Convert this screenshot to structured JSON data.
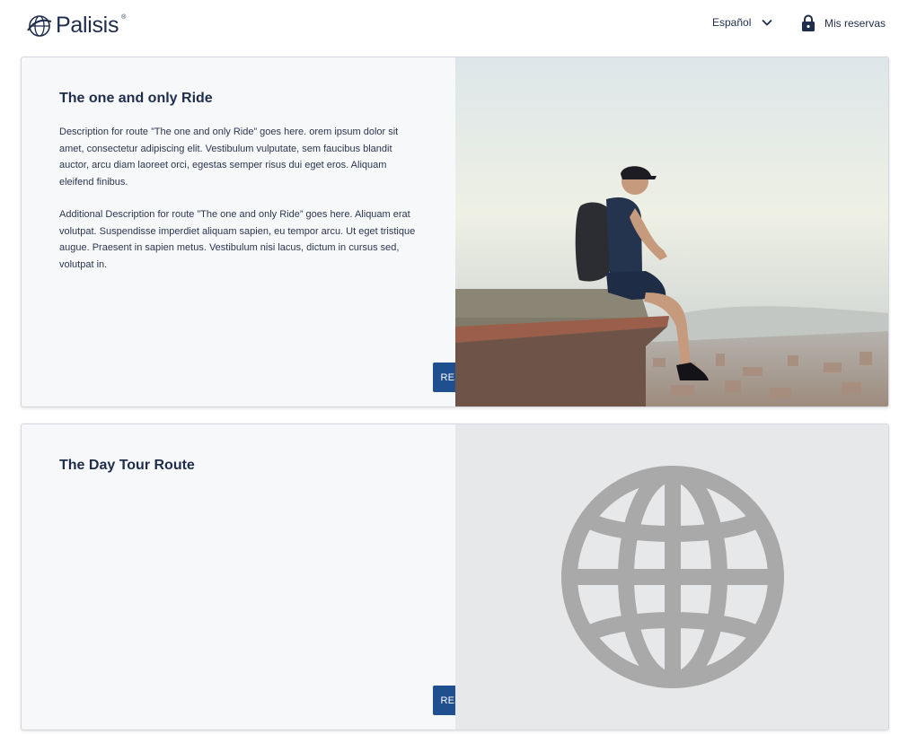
{
  "header": {
    "logo_text": "Palisis",
    "logo_mark": "®",
    "language_label": "Español",
    "my_bookings_label": "Mis reservas"
  },
  "routes": [
    {
      "title": "The one and only Ride",
      "description": "Description for route ”The one and only Ride” goes here. orem ipsum dolor sit amet, consectetur adipiscing elit. Vestibulum vulputate, sem faucibus blandit auctor, arcu diam laoreet orci, egestas semper risus dui eget eros. Aliquam eleifend finibus.",
      "additional_description": "Additional Description for route ”The one and only Ride” goes here. Aliquam erat volutpat. Suspendisse imperdiet aliquam sapien, eu tempor arcu. Ut eget tristique augue. Praesent in sapien metus. Vestibulum nisi lacus, dictum in cursus sed, volutpat in.",
      "button_label": "RESERVAR",
      "image": "hiker-on-ledge-city-view"
    },
    {
      "title": "The Day Tour Route",
      "button_label": "RESERVAR",
      "image": "globe-icon-placeholder"
    }
  ],
  "icons": {
    "logo": "palisis-globe-logo",
    "language_dropdown": "chevron-down-icon",
    "my_bookings": "lock-icon",
    "placeholder": "globe-icon"
  },
  "colors": {
    "brand_navy": "#1f2d4d",
    "button_blue": "#1f4f8f",
    "card_bg": "#f7f8fa",
    "placeholder_bg": "#e6e8ea",
    "globe_gray": "#a9a9a9"
  }
}
